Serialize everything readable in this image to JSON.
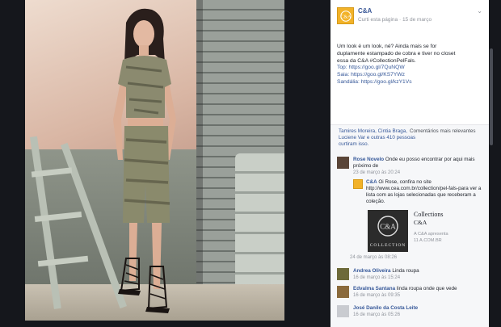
{
  "post": {
    "page_name": "C&A",
    "meta_prefix": "Curti esta página",
    "meta_date": "15 de março",
    "caption_lines": [
      "Um look é um look, né? Ainda mais se for",
      "duplamente estampado de cobra e tiver no closet",
      "essa da C&A #CollectionPelFals.",
      "Top: https://goo.gl/7QuNQW",
      "Saia: https://goo.gl/KS7YWz",
      "Sandália: https://goo.gl/kzY1Vs"
    ]
  },
  "likes": {
    "names": "Tamires Moreira, Cintia Braga, Luciene Var e",
    "others": "outras 410 pessoas curtiram isso.",
    "sort_label": "Comentários mais relevantes"
  },
  "comments": [
    {
      "name": "Rose Novelo",
      "text": "Onde eu posso encontrar por aqui mais próximo de",
      "time": "23 de março às 20:24"
    },
    {
      "name": "Andrea Oliveira",
      "text": "Linda roupa",
      "time": "16 de março às 15:24"
    },
    {
      "name": "Edvalma Santana",
      "text": "linda roupa onde que vede",
      "time": "16 de março às 09:35"
    },
    {
      "name": "José Danilo da Costa Leite",
      "text": "",
      "time": "16 de março às 05:26"
    }
  ],
  "reply": {
    "name": "C&A",
    "text": "Oi Rose, confira no site http://www.cea.com.br/collection/pel-fals-para ver a lista com as lojas selecionadas que receberam a coleção.",
    "time": "24 de março às 08:26"
  },
  "link_card": {
    "image_label": "COLLECTION",
    "title": "Collections",
    "subtitle": "C&A",
    "meta_line1": "A C&A apresenta",
    "meta_line2": "11 A.COM.BR"
  },
  "icons": {
    "page_avatar": "ca-logo-icon",
    "menu": "chevron-down-icon"
  },
  "colors": {
    "brand": "#f2b228",
    "link": "#365899"
  }
}
